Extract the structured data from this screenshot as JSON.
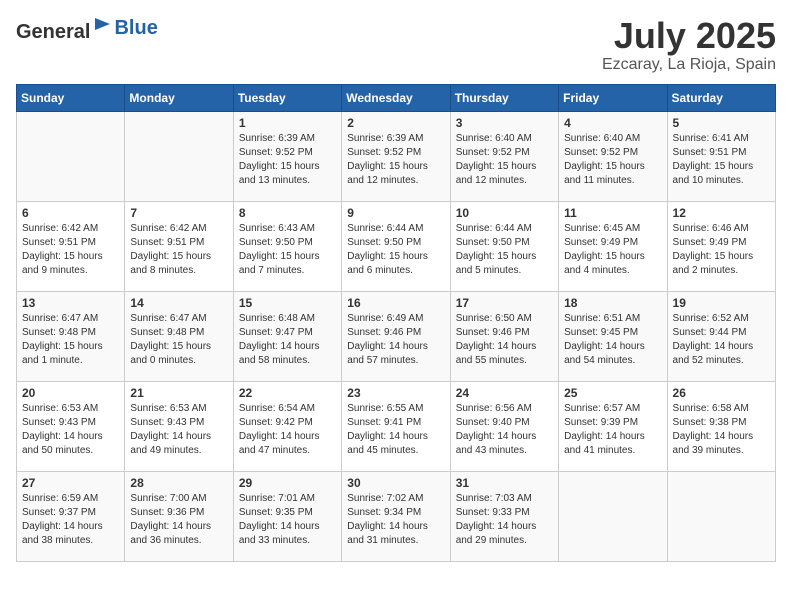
{
  "header": {
    "logo_general": "General",
    "logo_blue": "Blue",
    "month": "July 2025",
    "location": "Ezcaray, La Rioja, Spain"
  },
  "days_of_week": [
    "Sunday",
    "Monday",
    "Tuesday",
    "Wednesday",
    "Thursday",
    "Friday",
    "Saturday"
  ],
  "weeks": [
    [
      {
        "day": "",
        "info": ""
      },
      {
        "day": "",
        "info": ""
      },
      {
        "day": "1",
        "info": "Sunrise: 6:39 AM\nSunset: 9:52 PM\nDaylight: 15 hours\nand 13 minutes."
      },
      {
        "day": "2",
        "info": "Sunrise: 6:39 AM\nSunset: 9:52 PM\nDaylight: 15 hours\nand 12 minutes."
      },
      {
        "day": "3",
        "info": "Sunrise: 6:40 AM\nSunset: 9:52 PM\nDaylight: 15 hours\nand 12 minutes."
      },
      {
        "day": "4",
        "info": "Sunrise: 6:40 AM\nSunset: 9:52 PM\nDaylight: 15 hours\nand 11 minutes."
      },
      {
        "day": "5",
        "info": "Sunrise: 6:41 AM\nSunset: 9:51 PM\nDaylight: 15 hours\nand 10 minutes."
      }
    ],
    [
      {
        "day": "6",
        "info": "Sunrise: 6:42 AM\nSunset: 9:51 PM\nDaylight: 15 hours\nand 9 minutes."
      },
      {
        "day": "7",
        "info": "Sunrise: 6:42 AM\nSunset: 9:51 PM\nDaylight: 15 hours\nand 8 minutes."
      },
      {
        "day": "8",
        "info": "Sunrise: 6:43 AM\nSunset: 9:50 PM\nDaylight: 15 hours\nand 7 minutes."
      },
      {
        "day": "9",
        "info": "Sunrise: 6:44 AM\nSunset: 9:50 PM\nDaylight: 15 hours\nand 6 minutes."
      },
      {
        "day": "10",
        "info": "Sunrise: 6:44 AM\nSunset: 9:50 PM\nDaylight: 15 hours\nand 5 minutes."
      },
      {
        "day": "11",
        "info": "Sunrise: 6:45 AM\nSunset: 9:49 PM\nDaylight: 15 hours\nand 4 minutes."
      },
      {
        "day": "12",
        "info": "Sunrise: 6:46 AM\nSunset: 9:49 PM\nDaylight: 15 hours\nand 2 minutes."
      }
    ],
    [
      {
        "day": "13",
        "info": "Sunrise: 6:47 AM\nSunset: 9:48 PM\nDaylight: 15 hours\nand 1 minute."
      },
      {
        "day": "14",
        "info": "Sunrise: 6:47 AM\nSunset: 9:48 PM\nDaylight: 15 hours\nand 0 minutes."
      },
      {
        "day": "15",
        "info": "Sunrise: 6:48 AM\nSunset: 9:47 PM\nDaylight: 14 hours\nand 58 minutes."
      },
      {
        "day": "16",
        "info": "Sunrise: 6:49 AM\nSunset: 9:46 PM\nDaylight: 14 hours\nand 57 minutes."
      },
      {
        "day": "17",
        "info": "Sunrise: 6:50 AM\nSunset: 9:46 PM\nDaylight: 14 hours\nand 55 minutes."
      },
      {
        "day": "18",
        "info": "Sunrise: 6:51 AM\nSunset: 9:45 PM\nDaylight: 14 hours\nand 54 minutes."
      },
      {
        "day": "19",
        "info": "Sunrise: 6:52 AM\nSunset: 9:44 PM\nDaylight: 14 hours\nand 52 minutes."
      }
    ],
    [
      {
        "day": "20",
        "info": "Sunrise: 6:53 AM\nSunset: 9:43 PM\nDaylight: 14 hours\nand 50 minutes."
      },
      {
        "day": "21",
        "info": "Sunrise: 6:53 AM\nSunset: 9:43 PM\nDaylight: 14 hours\nand 49 minutes."
      },
      {
        "day": "22",
        "info": "Sunrise: 6:54 AM\nSunset: 9:42 PM\nDaylight: 14 hours\nand 47 minutes."
      },
      {
        "day": "23",
        "info": "Sunrise: 6:55 AM\nSunset: 9:41 PM\nDaylight: 14 hours\nand 45 minutes."
      },
      {
        "day": "24",
        "info": "Sunrise: 6:56 AM\nSunset: 9:40 PM\nDaylight: 14 hours\nand 43 minutes."
      },
      {
        "day": "25",
        "info": "Sunrise: 6:57 AM\nSunset: 9:39 PM\nDaylight: 14 hours\nand 41 minutes."
      },
      {
        "day": "26",
        "info": "Sunrise: 6:58 AM\nSunset: 9:38 PM\nDaylight: 14 hours\nand 39 minutes."
      }
    ],
    [
      {
        "day": "27",
        "info": "Sunrise: 6:59 AM\nSunset: 9:37 PM\nDaylight: 14 hours\nand 38 minutes."
      },
      {
        "day": "28",
        "info": "Sunrise: 7:00 AM\nSunset: 9:36 PM\nDaylight: 14 hours\nand 36 minutes."
      },
      {
        "day": "29",
        "info": "Sunrise: 7:01 AM\nSunset: 9:35 PM\nDaylight: 14 hours\nand 33 minutes."
      },
      {
        "day": "30",
        "info": "Sunrise: 7:02 AM\nSunset: 9:34 PM\nDaylight: 14 hours\nand 31 minutes."
      },
      {
        "day": "31",
        "info": "Sunrise: 7:03 AM\nSunset: 9:33 PM\nDaylight: 14 hours\nand 29 minutes."
      },
      {
        "day": "",
        "info": ""
      },
      {
        "day": "",
        "info": ""
      }
    ]
  ]
}
